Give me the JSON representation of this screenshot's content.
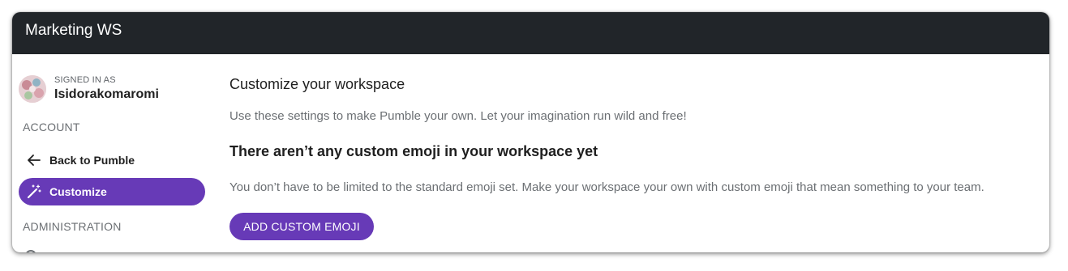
{
  "window": {
    "title": "Marketing WS"
  },
  "sidebar": {
    "user": {
      "signed_in_label": "SIGNED IN AS",
      "username": "Isidorakomaromi"
    },
    "account_label": "ACCOUNT",
    "items": [
      {
        "label": "Back to Pumble",
        "icon": "arrow-left-icon"
      },
      {
        "label": "Customize",
        "icon": "magic-wand-icon",
        "active": true
      }
    ],
    "administration_label": "ADMINISTRATION"
  },
  "main": {
    "title": "Customize your workspace",
    "description": "Use these settings to make Pumble your own. Let your imagination run wild and free!",
    "emoji_heading": "There aren’t any custom emoji in your workspace yet",
    "emoji_description": "You don’t have to be limited to the standard emoji set. Make your workspace your own with custom emoji that mean something to your team.",
    "add_button_label": "ADD CUSTOM EMOJI"
  },
  "colors": {
    "titlebar": "#212529",
    "accent": "#673ab7"
  }
}
